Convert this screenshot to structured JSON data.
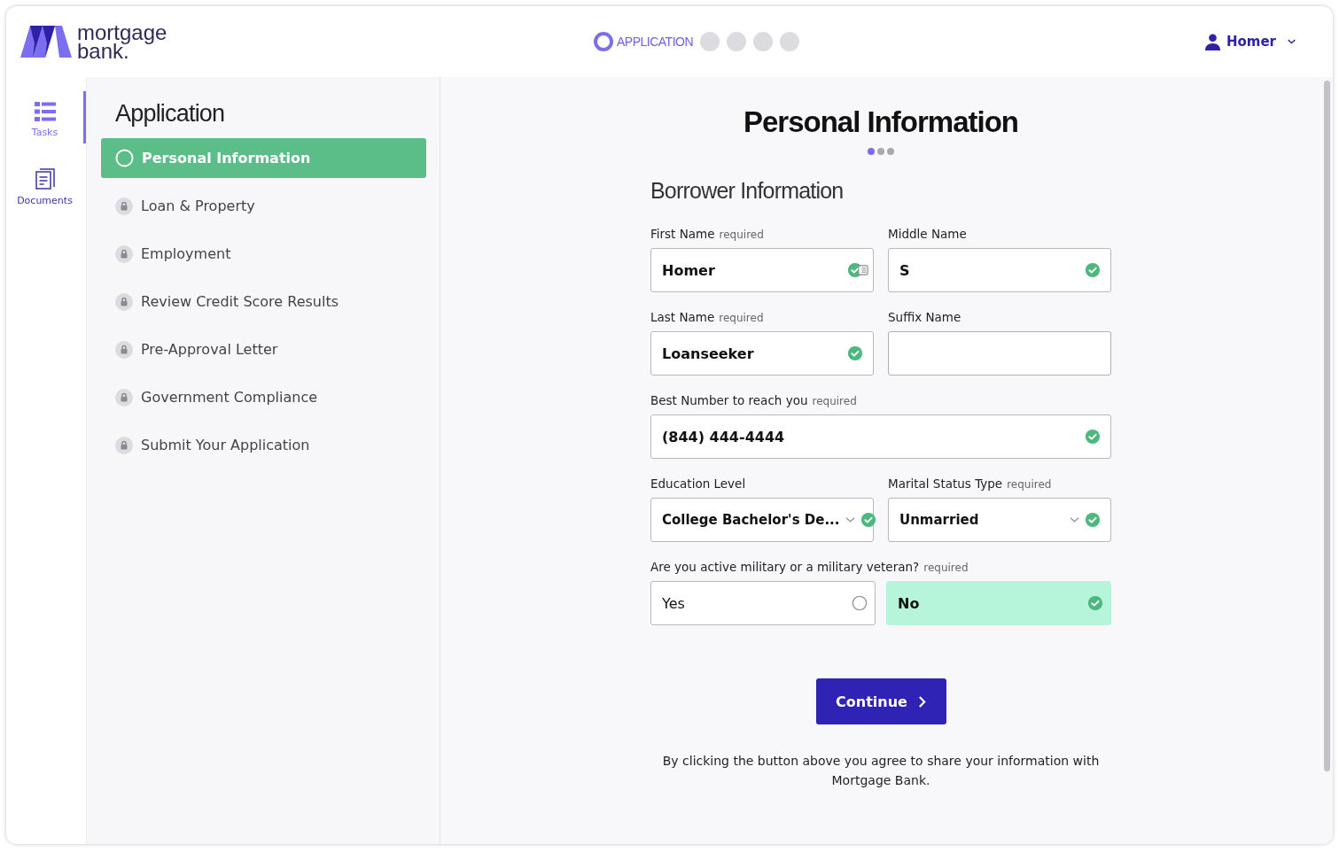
{
  "header": {
    "logo_lines": [
      "mortgage",
      "bank."
    ],
    "progress_steps": [
      {
        "label": "APPLICATION",
        "selected": true
      },
      {
        "selected": false
      },
      {
        "selected": false
      },
      {
        "selected": false
      },
      {
        "selected": false
      }
    ],
    "user_menu": {
      "name": "Homer"
    }
  },
  "rail": [
    {
      "label": "Tasks",
      "kind": "list",
      "selected": true
    },
    {
      "label": "Documents",
      "kind": "documents",
      "selected": false
    }
  ],
  "sidebar": {
    "title": "Application",
    "items": [
      {
        "label": "Personal Information",
        "selected": true,
        "locked": false
      },
      {
        "label": "Loan & Property",
        "selected": false,
        "locked": true
      },
      {
        "label": "Employment",
        "selected": false,
        "locked": true
      },
      {
        "label": "Review Credit Score Results",
        "selected": false,
        "locked": true
      },
      {
        "label": "Pre-Approval Letter",
        "selected": false,
        "locked": true
      },
      {
        "label": "Government Compliance",
        "selected": false,
        "locked": true
      },
      {
        "label": "Submit Your Application",
        "selected": false,
        "locked": true
      }
    ]
  },
  "form": {
    "title": "Personal Information",
    "step_dots": [
      {
        "selected": true
      },
      {
        "selected": false
      },
      {
        "selected": false
      }
    ],
    "section_title": "Borrower Information",
    "rows": [
      [
        {
          "kind": "text",
          "label": "First Name",
          "note": "required",
          "value": "Homer",
          "valid": true,
          "autofill": true
        },
        {
          "kind": "text",
          "label": "Middle Name",
          "value": "S",
          "valid": true
        }
      ],
      [
        {
          "kind": "text",
          "label": "Last Name",
          "note": "required",
          "value": "Loanseeker",
          "valid": true
        },
        {
          "kind": "text",
          "label": "Suffix Name",
          "valid": false
        }
      ],
      [
        {
          "kind": "text",
          "label": "Best Number to reach you",
          "note": "required",
          "value": "(844) 444-4444",
          "valid": true
        }
      ],
      [
        {
          "kind": "select",
          "label": "Education Level",
          "value": "College Bachelor's De...",
          "valid": true
        },
        {
          "kind": "select",
          "label": "Marital Status Type",
          "note": "required",
          "value": "Unmarried",
          "valid": true
        }
      ]
    ],
    "military": {
      "label": "Are you active military or a military veteran?",
      "note": "required",
      "options": [
        {
          "label": "Yes",
          "selected": false
        },
        {
          "label": "No",
          "selected": true
        }
      ]
    },
    "continue_button": "Continue",
    "disclaimer": "By clicking the button above you agree to share your information with Mortgage Bank."
  }
}
